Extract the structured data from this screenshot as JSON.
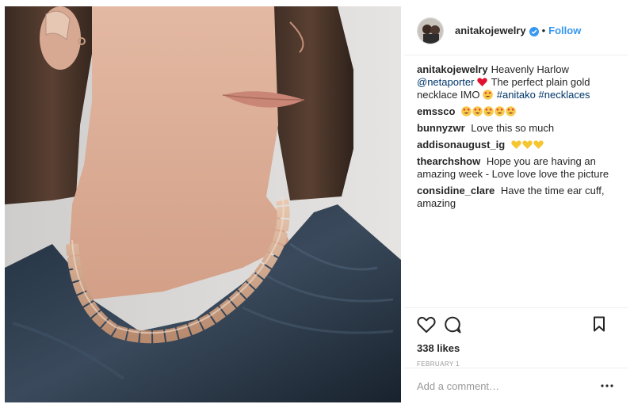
{
  "post": {
    "username": "anitakojewelry",
    "follow_label": "Follow",
    "separator": "•",
    "accent_color": "#3897f0",
    "caption": {
      "username": "anitakojewelry",
      "text_1": "Heavenly Harlow",
      "mention": "@netaporter",
      "text_2": "The perfect plain gold necklace IMO",
      "hashtag_1": "#anitako",
      "hashtag_2": "#necklaces"
    },
    "comments": [
      {
        "username": "emssco",
        "text": "",
        "emoji": [
          "heart-eyes",
          "heart-eyes",
          "heart-eyes",
          "heart-eyes",
          "heart-eyes"
        ]
      },
      {
        "username": "bunnyzwr",
        "text": "Love this so much"
      },
      {
        "username": "addisonaugust_ig",
        "text": "",
        "emoji": [
          "yellow-heart",
          "yellow-heart",
          "yellow-heart"
        ]
      },
      {
        "username": "thearchshow",
        "text": "Hope you are having an amazing week - Love love love the picture"
      },
      {
        "username": "considine_clare",
        "text": "Have the time ear cuff, amazing"
      }
    ],
    "likes": "338 likes",
    "date": "FEBRUARY 1",
    "comment_placeholder": "Add a comment…",
    "more_label": "•••"
  }
}
